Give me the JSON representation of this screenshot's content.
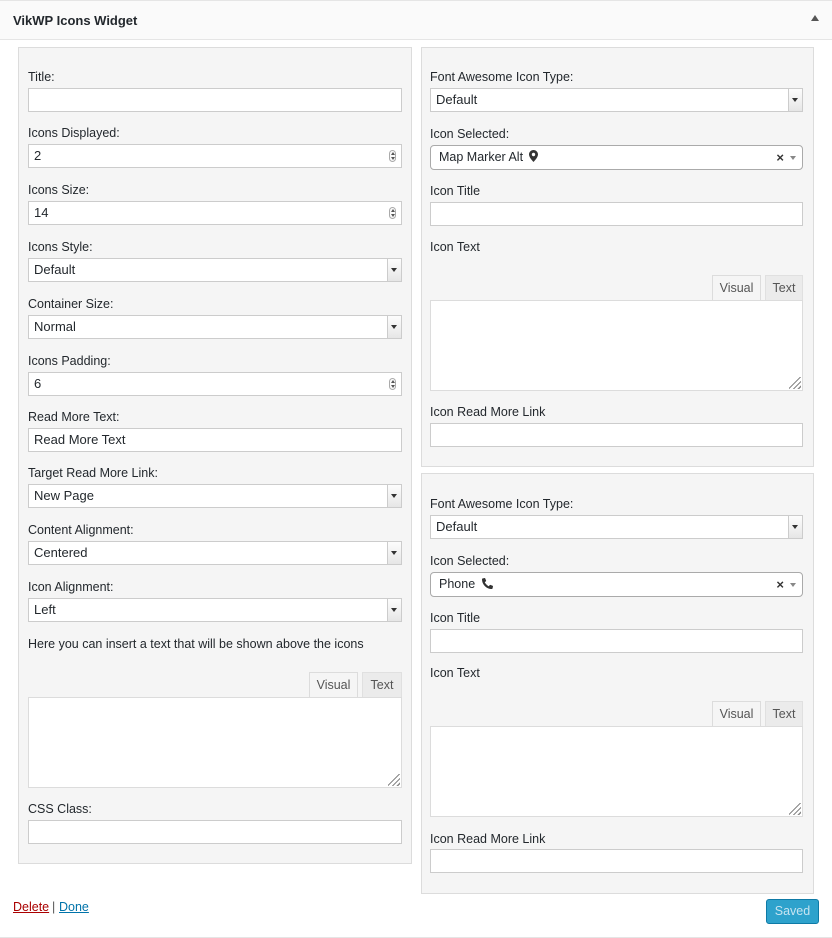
{
  "widget": {
    "title": "VikWP Icons Widget"
  },
  "left": {
    "title_label": "Title:",
    "title_value": "",
    "icons_displayed_label": "Icons Displayed:",
    "icons_displayed_value": "2",
    "icons_size_label": "Icons Size:",
    "icons_size_value": "14",
    "icons_style_label": "Icons Style:",
    "icons_style_value": "Default",
    "container_size_label": "Container Size:",
    "container_size_value": "Normal",
    "icons_padding_label": "Icons Padding:",
    "icons_padding_value": "6",
    "read_more_text_label": "Read More Text:",
    "read_more_text_value": "Read More Text",
    "target_label": "Target Read More Link:",
    "target_value": "New Page",
    "content_alignment_label": "Content Alignment:",
    "content_alignment_value": "Centered",
    "icon_alignment_label": "Icon Alignment:",
    "icon_alignment_value": "Left",
    "above_text_hint": "Here you can insert a text that will be shown above the icons",
    "tab_visual": "Visual",
    "tab_text": "Text",
    "css_class_label": "CSS Class:",
    "css_class_value": ""
  },
  "icons": [
    {
      "type_label": "Font Awesome Icon Type:",
      "type_value": "Default",
      "selected_label": "Icon Selected:",
      "selected_value": "Map Marker Alt",
      "selected_icon": "map-marker-icon",
      "title_label": "Icon Title",
      "title_value": "",
      "text_label": "Icon Text",
      "tab_visual": "Visual",
      "tab_text": "Text",
      "link_label": "Icon Read More Link",
      "link_value": ""
    },
    {
      "type_label": "Font Awesome Icon Type:",
      "type_value": "Default",
      "selected_label": "Icon Selected:",
      "selected_value": "Phone",
      "selected_icon": "phone-icon",
      "title_label": "Icon Title",
      "title_value": "",
      "text_label": "Icon Text",
      "tab_visual": "Visual",
      "tab_text": "Text",
      "link_label": "Icon Read More Link",
      "link_value": ""
    }
  ],
  "footer": {
    "delete": "Delete",
    "separator": "|",
    "done": "Done",
    "saved": "Saved"
  },
  "colors": {
    "primary": "#2ea2cc",
    "delete_link": "#a00",
    "done_link": "#0073aa"
  }
}
